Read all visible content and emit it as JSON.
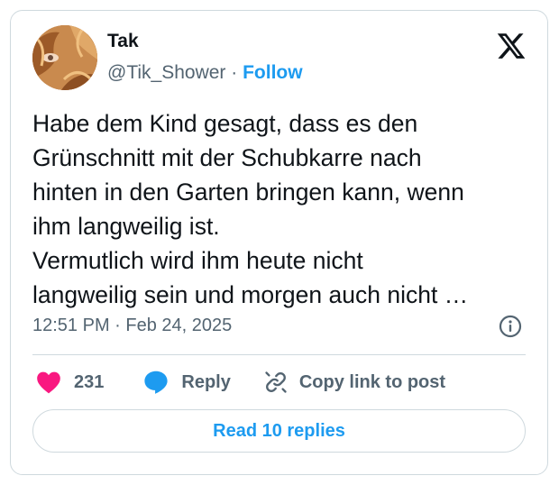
{
  "author": {
    "name": "Tak",
    "handle": "@Tik_Shower",
    "separator": " · ",
    "follow_label": "Follow"
  },
  "tweet": {
    "lines": [
      "Habe dem Kind gesagt, dass es den",
      "Grünschnitt mit der Schubkarre nach",
      "hinten in den Garten bringen kann, wenn",
      "ihm langweilig ist.",
      "Vermutlich wird ihm heute nicht",
      "langweilig sein und morgen auch nicht …"
    ],
    "time": "12:51 PM",
    "date_separator": " · ",
    "date": "Feb 24, 2025"
  },
  "actions": {
    "like_count": "231",
    "reply_label": "Reply",
    "copy_label": "Copy link to post"
  },
  "read_replies_label": "Read 10 replies",
  "icons": {
    "logo": "x-logo-icon",
    "info": "info-icon",
    "like": "heart-icon",
    "reply": "speech-bubble-icon",
    "copy": "link-icon"
  },
  "colors": {
    "accent": "#1d9bf0",
    "like": "#f91880",
    "secondary_text": "#536471",
    "border": "#cfd9de"
  }
}
